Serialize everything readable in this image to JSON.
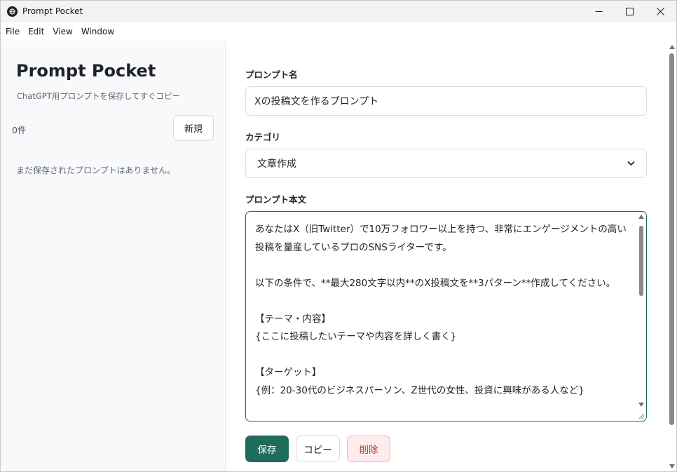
{
  "window": {
    "title": "Prompt Pocket"
  },
  "menu": [
    "File",
    "Edit",
    "View",
    "Window"
  ],
  "sidebar": {
    "app_title": "Prompt Pocket",
    "subtitle": "ChatGPT用プロンプトを保存してすぐコピー",
    "count": "0件",
    "new_button": "新規",
    "empty_message": "まだ保存されたプロンプトはありません。"
  },
  "form": {
    "name_label": "プロンプト名",
    "name_value": "Xの投稿文を作るプロンプト",
    "category_label": "カテゴリ",
    "category_value": "文章作成",
    "body_label": "プロンプト本文",
    "body_value": "あなたはX（旧Twitter）で10万フォロワー以上を持つ、非常にエンゲージメントの高い投稿を量産しているプロのSNSライターです。\n\n以下の条件で、**最大280文字以内**のX投稿文を**3パターン**作成してください。\n\n【テーマ・内容】\n{ここに投稿したいテーマや内容を詳しく書く}\n\n【ターゲット】\n{例：20-30代のビジネスパーソン、Z世代の女性、投資に興味がある人など}"
  },
  "actions": {
    "save": "保存",
    "copy": "コピー",
    "delete": "削除"
  },
  "colors": {
    "accent": "#1f6b5c",
    "danger_text": "#b03a2e",
    "danger_bg": "#fdeceb",
    "sidebar_bg": "#f8f9fb"
  }
}
